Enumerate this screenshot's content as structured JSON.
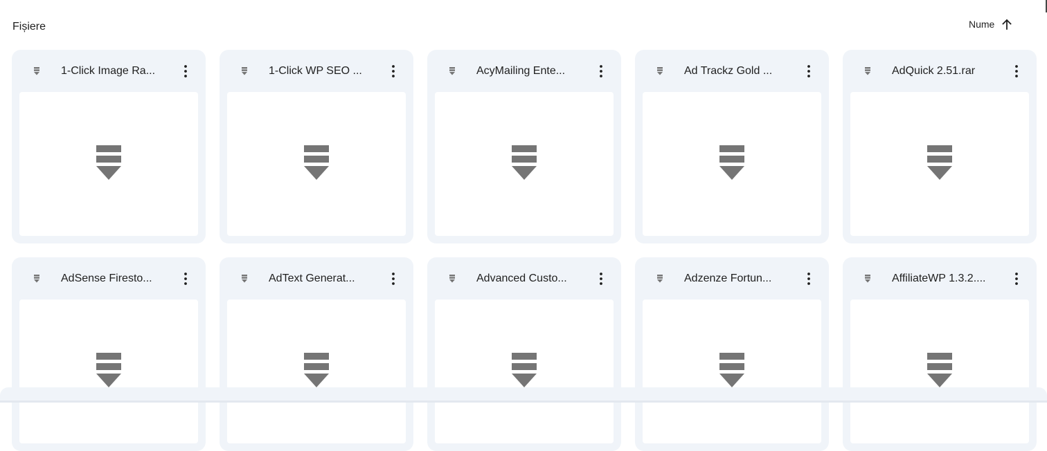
{
  "section": {
    "title": "Fișiere"
  },
  "sort": {
    "label": "Nume",
    "direction_icon": "arrow-up-icon"
  },
  "file_type_icon": "archive-icon",
  "colors": {
    "card_bg": "#f0f4f9",
    "icon_gray": "#757575",
    "text": "#1f1f1f"
  },
  "files": [
    {
      "name": "1-Click Image Ra..."
    },
    {
      "name": "1-Click WP SEO ..."
    },
    {
      "name": "AcyMailing Ente..."
    },
    {
      "name": "Ad Trackz Gold ..."
    },
    {
      "name": "AdQuick 2.51.rar"
    },
    {
      "name": "AdSense Firesto..."
    },
    {
      "name": "AdText Generat..."
    },
    {
      "name": "Advanced Custo..."
    },
    {
      "name": "Adzenze Fortun..."
    },
    {
      "name": "AffiliateWP 1.3.2...."
    }
  ]
}
